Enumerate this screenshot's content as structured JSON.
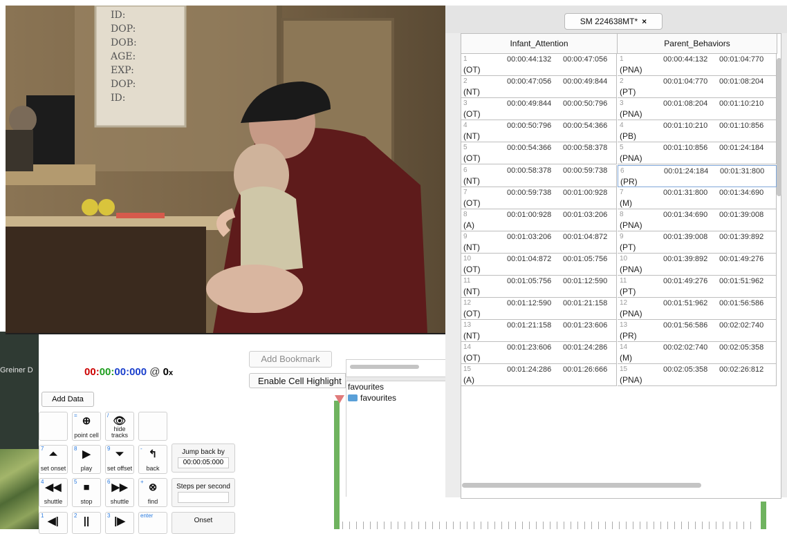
{
  "controller": {
    "video_label": "Greiner D",
    "timecode": {
      "h": "00",
      "m": "00",
      "s": "00",
      "ms": "000",
      "sep": ":",
      "at": "@",
      "rate": "0",
      "rate_unit": "x"
    },
    "add_data_label": "Add Data",
    "row1": [
      {
        "num": "",
        "glyph": "",
        "label": ""
      },
      {
        "num": "=",
        "glyph": "⊕",
        "label": "point cell"
      },
      {
        "num": "/",
        "glyph": "👁",
        "label": "hide tracks"
      },
      {
        "num": "",
        "glyph": "",
        "label": ""
      }
    ],
    "row2": [
      {
        "num": "7",
        "glyph": "⏶",
        "label": "set onset"
      },
      {
        "num": "8",
        "glyph": "▶",
        "label": "play"
      },
      {
        "num": "9",
        "glyph": "⏷",
        "label": "set offset"
      },
      {
        "num": "-",
        "glyph": "↰",
        "label": "back"
      }
    ],
    "row3": [
      {
        "num": "4",
        "glyph": "◀◀",
        "label": "shuttle"
      },
      {
        "num": "5",
        "glyph": "■",
        "label": "stop"
      },
      {
        "num": "6",
        "glyph": "▶▶",
        "label": "shuttle"
      },
      {
        "num": "+",
        "glyph": "⊗",
        "label": "find"
      }
    ],
    "row4": [
      {
        "num": "1",
        "glyph": "◀|",
        "label": ""
      },
      {
        "num": "2",
        "glyph": "||",
        "label": ""
      },
      {
        "num": "3",
        "glyph": "|▶",
        "label": ""
      },
      {
        "num": "enter",
        "glyph": "",
        "label": ""
      }
    ],
    "jump_back": {
      "label": "Jump back by",
      "value": "00:00:05:000"
    },
    "steps_per_second": {
      "label": "Steps per second",
      "value": ""
    },
    "onset": {
      "label": "Onset"
    },
    "add_bookmark_label": "Add Bookmark",
    "enable_cell_label": "Enable Cell Highlight"
  },
  "video": {
    "whiteboard_lines": [
      "ID:",
      "DOP:",
      "DOB:",
      "AGE:",
      "EXP:",
      "DOP:",
      "ID:"
    ]
  },
  "favourites": {
    "title": "favourites",
    "item": "favourites"
  },
  "spreadsheet": {
    "tab_title": "SM 224638MT*",
    "tab_close": "×",
    "columns": [
      {
        "name": "Infant_Attention",
        "cells": [
          {
            "ord": "1",
            "onset": "00:00:44:132",
            "offset": "00:00:47:056",
            "code": "(OT)"
          },
          {
            "ord": "2",
            "onset": "00:00:47:056",
            "offset": "00:00:49:844",
            "code": "(NT)"
          },
          {
            "ord": "3",
            "onset": "00:00:49:844",
            "offset": "00:00:50:796",
            "code": "(OT)"
          },
          {
            "ord": "4",
            "onset": "00:00:50:796",
            "offset": "00:00:54:366",
            "code": "(NT)"
          },
          {
            "ord": "5",
            "onset": "00:00:54:366",
            "offset": "00:00:58:378",
            "code": "(OT)"
          },
          {
            "ord": "6",
            "onset": "00:00:58:378",
            "offset": "00:00:59:738",
            "code": "(NT)"
          },
          {
            "ord": "7",
            "onset": "00:00:59:738",
            "offset": "00:01:00:928",
            "code": "(OT)"
          },
          {
            "ord": "8",
            "onset": "00:01:00:928",
            "offset": "00:01:03:206",
            "code": "(A)"
          },
          {
            "ord": "9",
            "onset": "00:01:03:206",
            "offset": "00:01:04:872",
            "code": "(NT)"
          },
          {
            "ord": "10",
            "onset": "00:01:04:872",
            "offset": "00:01:05:756",
            "code": "(OT)"
          },
          {
            "ord": "11",
            "onset": "00:01:05:756",
            "offset": "00:01:12:590",
            "code": "(NT)"
          },
          {
            "ord": "12",
            "onset": "00:01:12:590",
            "offset": "00:01:21:158",
            "code": "(OT)"
          },
          {
            "ord": "13",
            "onset": "00:01:21:158",
            "offset": "00:01:23:606",
            "code": "(NT)"
          },
          {
            "ord": "14",
            "onset": "00:01:23:606",
            "offset": "00:01:24:286",
            "code": "(OT)"
          },
          {
            "ord": "15",
            "onset": "00:01:24:286",
            "offset": "00:01:26:666",
            "code": "(A)"
          }
        ]
      },
      {
        "name": "Parent_Behaviors",
        "cells": [
          {
            "ord": "1",
            "onset": "00:00:44:132",
            "offset": "00:01:04:770",
            "code": "(PNA)"
          },
          {
            "ord": "2",
            "onset": "00:01:04:770",
            "offset": "00:01:08:204",
            "code": "(PT)"
          },
          {
            "ord": "3",
            "onset": "00:01:08:204",
            "offset": "00:01:10:210",
            "code": "(PNA)"
          },
          {
            "ord": "4",
            "onset": "00:01:10:210",
            "offset": "00:01:10:856",
            "code": "(PB)"
          },
          {
            "ord": "5",
            "onset": "00:01:10:856",
            "offset": "00:01:24:184",
            "code": "(PNA)"
          },
          {
            "ord": "6",
            "onset": "00:01:24:184",
            "offset": "00:01:31:800",
            "code": "(PR)"
          },
          {
            "ord": "7",
            "onset": "00:01:31:800",
            "offset": "00:01:34:690",
            "code": "(M)"
          },
          {
            "ord": "8",
            "onset": "00:01:34:690",
            "offset": "00:01:39:008",
            "code": "(PNA)"
          },
          {
            "ord": "9",
            "onset": "00:01:39:008",
            "offset": "00:01:39:892",
            "code": "(PT)"
          },
          {
            "ord": "10",
            "onset": "00:01:39:892",
            "offset": "00:01:49:276",
            "code": "(PNA)"
          },
          {
            "ord": "11",
            "onset": "00:01:49:276",
            "offset": "00:01:51:962",
            "code": "(PT)"
          },
          {
            "ord": "12",
            "onset": "00:01:51:962",
            "offset": "00:01:56:586",
            "code": "(PNA)"
          },
          {
            "ord": "13",
            "onset": "00:01:56:586",
            "offset": "00:02:02:740",
            "code": "(PR)"
          },
          {
            "ord": "14",
            "onset": "00:02:02:740",
            "offset": "00:02:05:358",
            "code": "(M)"
          },
          {
            "ord": "15",
            "onset": "00:02:05:358",
            "offset": "00:02:26:812",
            "code": "(PNA)"
          }
        ]
      }
    ]
  }
}
